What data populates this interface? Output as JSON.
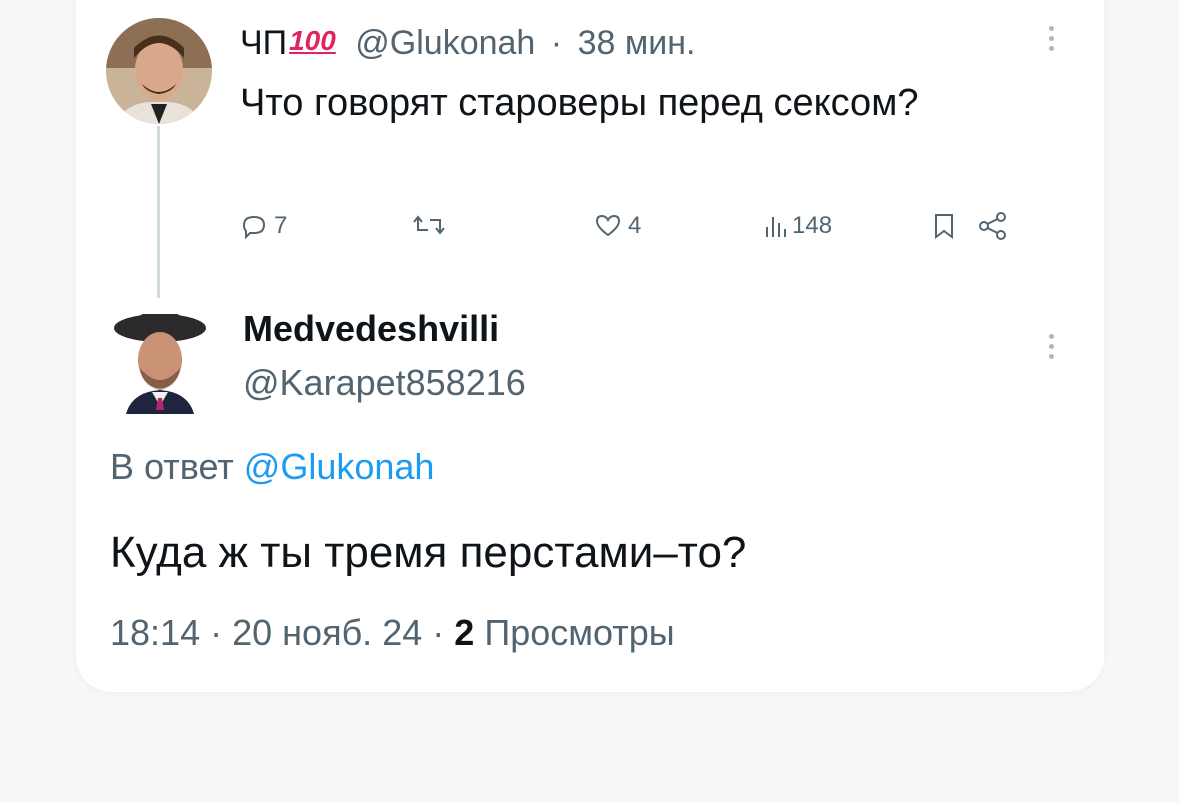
{
  "parent_tweet": {
    "display_name": "ЧП",
    "emoji": "100",
    "handle": "@Glukonah",
    "separator": "·",
    "time_ago": "38 мин.",
    "text": "Что говорят староверы перед сексом?",
    "actions": {
      "replies": "7",
      "retweets": "",
      "likes": "4",
      "views": "148"
    }
  },
  "reply_tweet": {
    "display_name": "Medvedeshvilli",
    "handle": "@Karapet858216",
    "reply_prefix": "В ответ",
    "reply_to_handle": "@Glukonah",
    "text": "Куда ж ты тремя перстами–то?",
    "time": "18:14",
    "separator1": "·",
    "date": "20 нояб. 24",
    "separator2": "·",
    "views_count": "2",
    "views_label": "Просмотры"
  },
  "colors": {
    "link": "#1d9bf0",
    "secondary_text": "#536471",
    "primary_text": "#0f1419"
  }
}
